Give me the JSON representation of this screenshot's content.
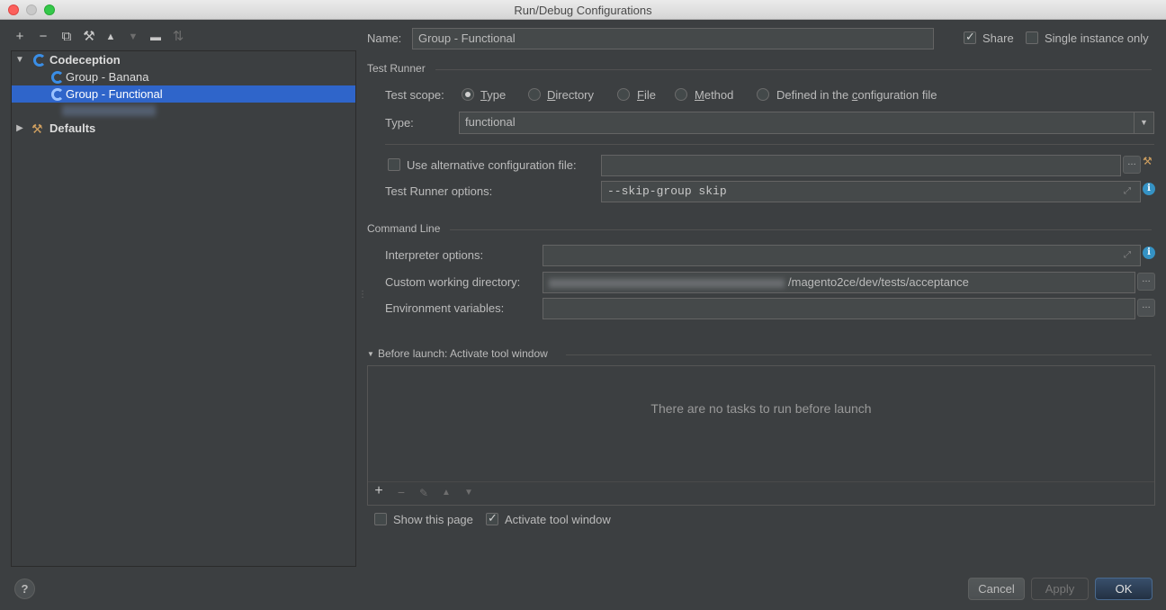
{
  "window": {
    "title": "Run/Debug Configurations"
  },
  "left_toolbar": {
    "icons": [
      "add-icon",
      "remove-icon",
      "copy-icon",
      "edit-defaults-icon",
      "move-up-icon",
      "move-down-icon",
      "folder-icon",
      "sort-icon"
    ],
    "glyphs": [
      "+",
      "−",
      "⧉",
      "⚒",
      "▲",
      "▼",
      "▬",
      "⇅"
    ]
  },
  "tree": {
    "root": {
      "label": "Codeception"
    },
    "items": [
      {
        "label": "Group - Banana"
      },
      {
        "label": "Group - Functional",
        "selected": true
      }
    ],
    "defaults": {
      "label": "Defaults"
    }
  },
  "form": {
    "name_label": "Name:",
    "name_value": "Group - Functional",
    "share_label": "Share",
    "share_checked": true,
    "single_instance_label": "Single instance only",
    "single_instance_checked": false,
    "test_runner": {
      "title": "Test Runner",
      "scope_label": "Test scope:",
      "scopes": [
        {
          "label": "Type",
          "mnemonic": "T",
          "rest": "ype",
          "checked": true
        },
        {
          "label": "Directory",
          "mnemonic": "D",
          "rest": "irectory",
          "checked": false
        },
        {
          "label": "File",
          "mnemonic": "F",
          "rest": "ile",
          "checked": false
        },
        {
          "label": "Method",
          "mnemonic": "M",
          "rest": "ethod",
          "checked": false
        },
        {
          "label": "Defined in the configuration file",
          "prefix": "Defined in the ",
          "mnemonic": "c",
          "rest": "onfiguration file",
          "checked": false
        }
      ],
      "type_label": "Type:",
      "type_value": "functional",
      "alt_config_label": "Use alternative configuration file:",
      "alt_config_checked": false,
      "alt_config_value": "",
      "options_label": "Test Runner options:",
      "options_value": "--skip-group skip"
    },
    "command_line": {
      "title": "Command Line",
      "interpreter_label": "Interpreter options:",
      "interpreter_value": "",
      "working_dir_label": "Custom working directory:",
      "working_dir_value": "/magento2ce/dev/tests/acceptance",
      "env_label": "Environment variables:",
      "env_value": ""
    },
    "before_launch": {
      "title": "Before launch: Activate tool window",
      "empty_text": "There are no tasks to run before launch",
      "toolbar_icons": [
        "add-icon",
        "remove-icon",
        "edit-icon",
        "move-up-icon",
        "move-down-icon"
      ],
      "toolbar_glyphs": [
        "+",
        "−",
        "✎",
        "▲",
        "▼"
      ],
      "show_page_label": "Show this page",
      "show_page_checked": false,
      "activate_label": "Activate tool window",
      "activate_checked": true
    }
  },
  "buttons": {
    "help": "?",
    "cancel": "Cancel",
    "apply": "Apply",
    "ok": "OK"
  }
}
